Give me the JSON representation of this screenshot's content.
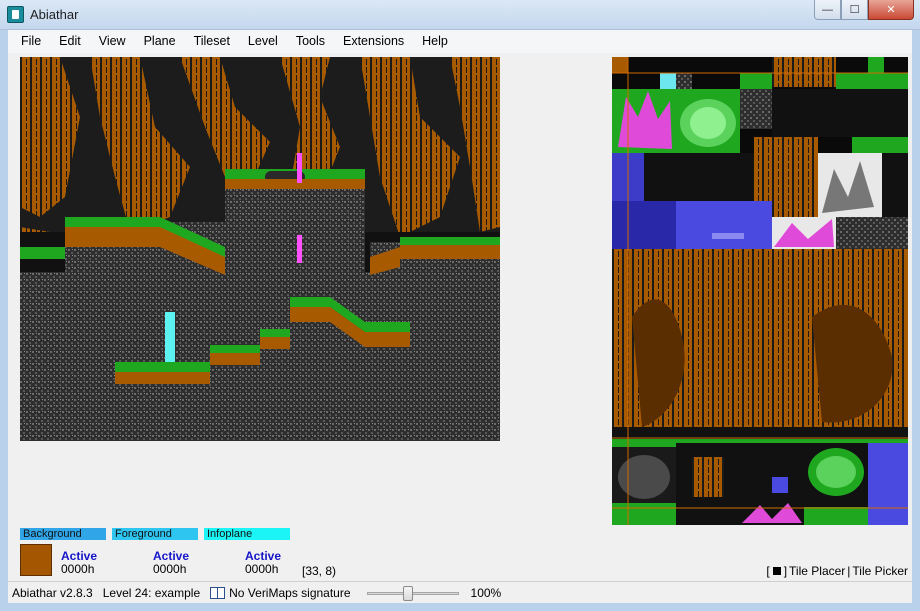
{
  "window": {
    "title": "Abiathar",
    "buttons": {
      "minimize": "—",
      "maximize": "☐",
      "close": "✕"
    }
  },
  "menu": [
    "File",
    "Edit",
    "View",
    "Plane",
    "Tileset",
    "Level",
    "Tools",
    "Extensions",
    "Help"
  ],
  "map_view": {
    "icon": "level-map-view",
    "palette": {
      "bark": "#a45a00",
      "grass": "#1fa81f",
      "rock": "#3b3b3b",
      "pole_magenta": "#ff4fff",
      "pole_cyan": "#5cf2f2"
    }
  },
  "tile_palette": {
    "icon": "tile-picker-palette"
  },
  "planes": [
    {
      "name": "Background",
      "state": "Active",
      "value": "0000h",
      "color": "#30a6e9"
    },
    {
      "name": "Foreground",
      "state": "Active",
      "value": "0000h",
      "color": "#2ec6f1"
    },
    {
      "name": "Infoplane",
      "state": "Active",
      "value": "0000h",
      "color": "#1cf5f5"
    }
  ],
  "selected_tile_color": "#a45600",
  "cursor_coords": "[33, 8)",
  "tool_mode": {
    "bracket_open": "[",
    "bracket_close": "]",
    "placer": "Tile Placer",
    "separator": "|",
    "picker": "Tile Picker"
  },
  "status": {
    "version": "Abiathar v2.8.3",
    "level": "Level 24: example",
    "signature": "No VeriMaps signature",
    "zoom_percent": "100%",
    "zoom_slider_fraction": 0.44
  }
}
